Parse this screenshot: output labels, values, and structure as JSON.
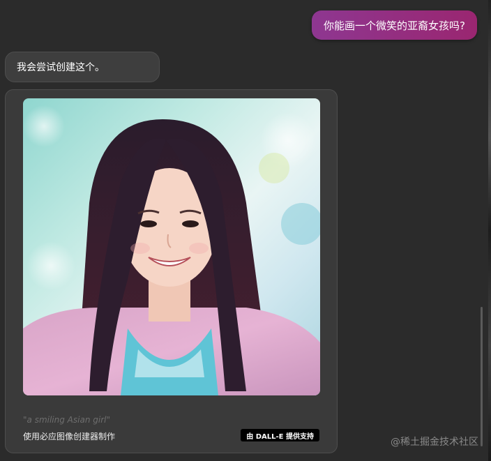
{
  "conversation": {
    "user_message": "你能画一个微笑的亚裔女孩吗?",
    "assistant_message": "我会尝试创建这个。"
  },
  "image_card": {
    "prompt": "\"a smiling Asian girl\"",
    "made_with": "使用必应图像创建器制作",
    "badge": "由 DALL-E 提供支持"
  },
  "watermark": "@稀土掘金技术社区",
  "colors": {
    "background": "#2b2b2b",
    "user_bubble_start": "#8e3791",
    "user_bubble_end": "#9a2670",
    "assistant_bubble": "#3e3e3e",
    "card": "#3a3a3a"
  }
}
